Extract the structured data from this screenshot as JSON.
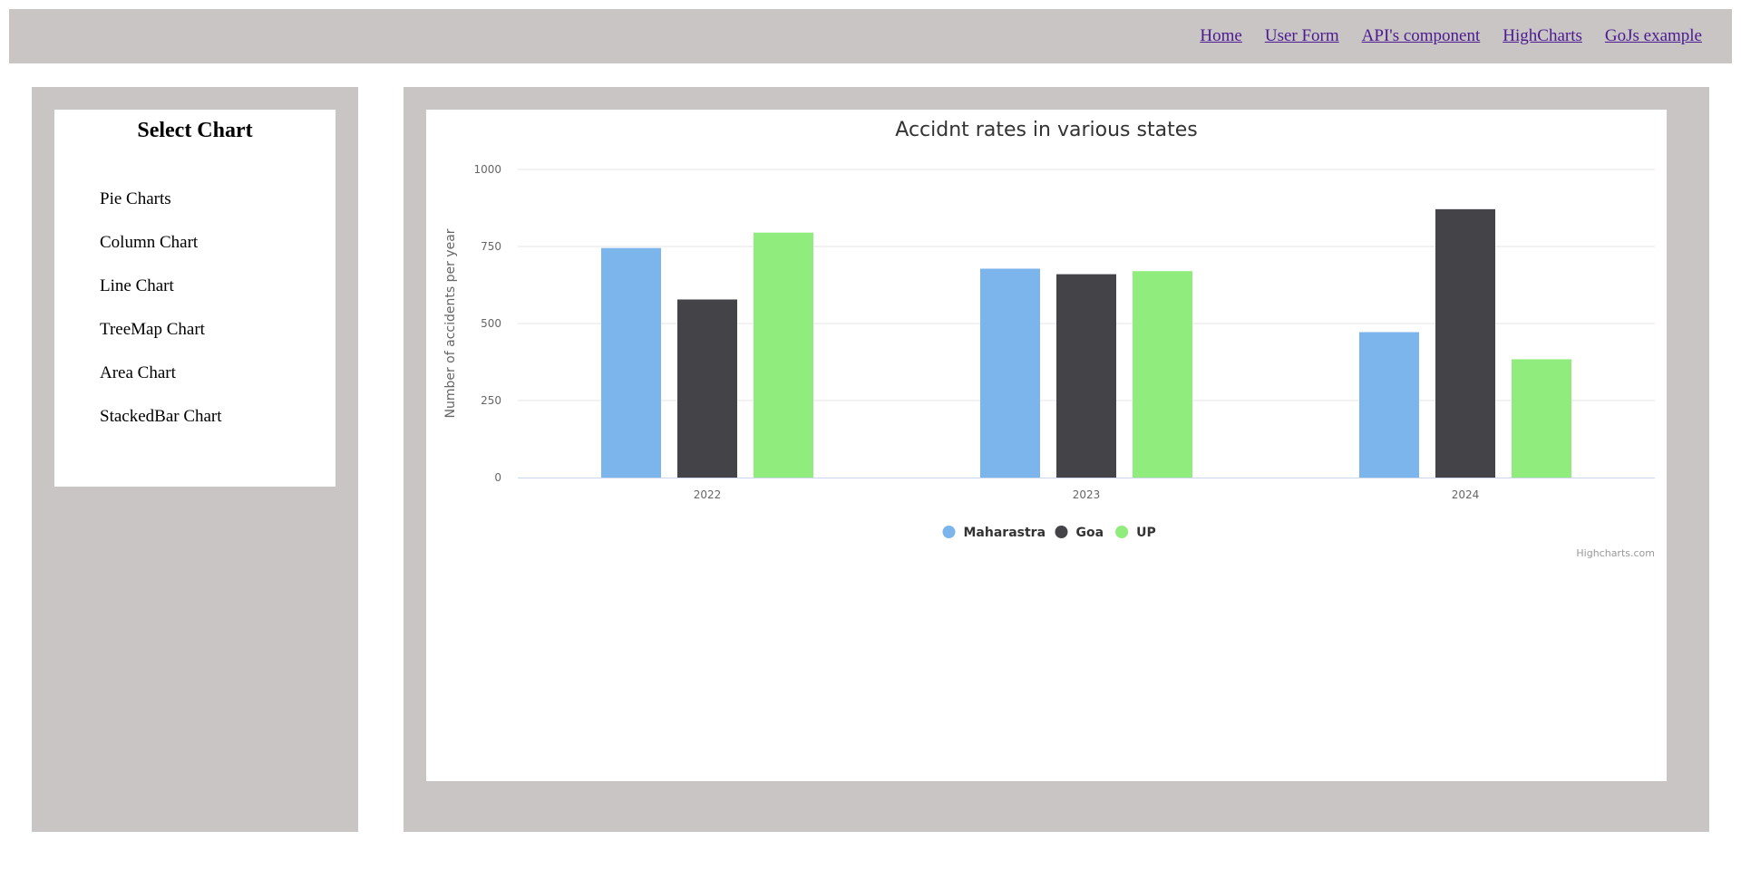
{
  "nav": {
    "links": [
      "Home",
      "User Form",
      "API's component",
      "HighCharts",
      "GoJs example"
    ],
    "link_color": "#4b1a91"
  },
  "sidebar": {
    "title": "Select Chart",
    "items": [
      "Pie Charts",
      "Column Chart",
      "Line Chart",
      "TreeMap Chart",
      "Area Chart",
      "StackedBar Chart"
    ]
  },
  "chart_data": {
    "type": "bar",
    "title": "Accidnt rates in various states",
    "ylabel": "Number of accidents per year",
    "xlabel": "",
    "categories": [
      "2022",
      "2023",
      "2024"
    ],
    "ylim": [
      0,
      1000
    ],
    "yticks": [
      0,
      250,
      500,
      750,
      1000
    ],
    "grid": true,
    "legend_position": "bottom-center",
    "series": [
      {
        "name": "Maharastra",
        "color": "#7cb5ec",
        "values": [
          745,
          678,
          472
        ]
      },
      {
        "name": "Goa",
        "color": "#434348",
        "values": [
          578,
          660,
          871
        ]
      },
      {
        "name": "UP",
        "color": "#90ed7d",
        "values": [
          795,
          670,
          384
        ]
      }
    ],
    "credits": "Highcharts.com"
  }
}
